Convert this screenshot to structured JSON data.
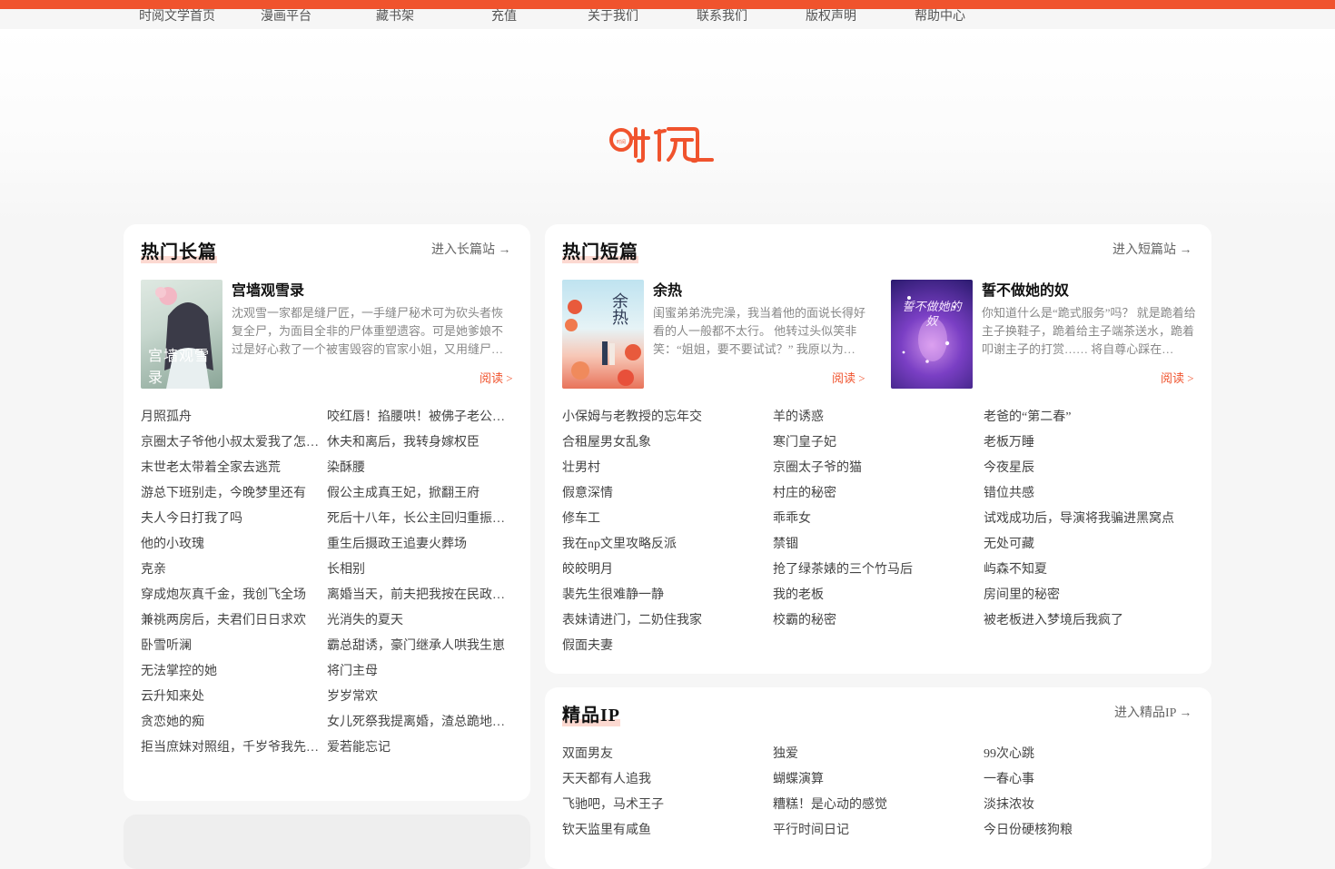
{
  "nav": [
    "时阅文学首页",
    "漫画平台",
    "藏书架",
    "充值",
    "关于我们",
    "联系我们",
    "版权声明",
    "帮助中心"
  ],
  "brand": {
    "logo_text": "时阅",
    "accent": "#f0532d"
  },
  "long_section": {
    "title": "热门长篇",
    "more": "进入长篇站 →",
    "featured": {
      "title": "宫墙观雪录",
      "cover_text": "宫墙观雪录",
      "desc": "沈观雪一家都是缝尸匠，一手缝尸秘术可为砍头者恢复全尸，为面目全非的尸体重塑遗容。可是她爹娘不过是好心救了一个被害毁容的官家小姐，又用缝尸…",
      "read": "阅读 >"
    },
    "col1": [
      "月照孤舟",
      "京圈太子爷他小叔太爱我了怎么办",
      "末世老太带着全家去逃荒",
      "游总下班别走，今晚梦里还有",
      "夫人今日打我了吗",
      "他的小玫瑰",
      "克亲",
      "穿成炮灰真千金，我创飞全场",
      "兼祧两房后，夫君们日日求欢",
      "卧雪听澜",
      "无法掌控的她",
      "云升知来处",
      "贪恋她的痴",
      "拒当庶妹对照组，千岁爷我先撩为敬"
    ],
    "col2": [
      "咬红唇！掐腰哄！被佛子老公宠上天",
      "休夫和离后，我转身嫁权臣",
      "染酥腰",
      "假公主成真王妃，掀翻王府",
      "死后十八年，长公主回归重振朝纲",
      "重生后摄政王追妻火葬场",
      "长相别",
      "离婚当天，前夫把我按在民政局门口",
      "光消失的夏天",
      "霸总甜诱，豪门继承人哄我生崽",
      "将门主母",
      "岁岁常欢",
      "女儿死祭我提离婚，渣总跪地求原谅",
      "爱若能忘记"
    ]
  },
  "short_section": {
    "title": "热门短篇",
    "more": "进入短篇站 →",
    "featured": [
      {
        "title": "余热",
        "cover_text": "余热",
        "desc": "闺蜜弟弟洗完澡，我当着他的面说长得好看的人一般都不太行。 他转过头似笑非笑：“姐姐，要不要试试？” 我原以为…",
        "read": "阅读 >"
      },
      {
        "title": "誓不做她的奴",
        "cover_text": "誓不做她的奴",
        "desc": "你知道什么是“跪式服务”吗？ 就是跪着给主子换鞋子，跪着给主子端茶送水，跪着叩谢主子的打赏…… 将自尊心踩在…",
        "read": "阅读 >"
      }
    ],
    "col1": [
      "小保姆与老教授的忘年交",
      "合租屋男女乱象",
      "壮男村",
      "假意深情",
      "修车工",
      "我在np文里攻略反派",
      "皎皎明月",
      "裴先生很难静一静",
      "表妹请进门，二奶住我家",
      "假面夫妻"
    ],
    "col2": [
      "羊的诱惑",
      "寒门皇子妃",
      "京圈太子爷的猫",
      "村庄的秘密",
      "乖乖女",
      "禁锢",
      "抢了绿茶婊的三个竹马后",
      "我的老板",
      "校霸的秘密"
    ],
    "col3": [
      "老爸的“第二春”",
      "老板万睡",
      "今夜星辰",
      "错位共感",
      "试戏成功后，导演将我骗进黑窝点",
      "无处可藏",
      "屿森不知夏",
      "房间里的秘密",
      "被老板进入梦境后我疯了"
    ]
  },
  "ip_section": {
    "title": "精品IP",
    "more": "进入精品IP →",
    "col1": [
      "双面男友",
      "天天都有人追我",
      "飞驰吧，马术王子",
      "钦天监里有咸鱼"
    ],
    "col2": [
      "独爱",
      "蝴蝶演算",
      "糟糕！是心动的感觉",
      "平行时间日记"
    ],
    "col3": [
      "99次心跳",
      "一春心事",
      "淡抹浓妆",
      "今日份硬核狗粮"
    ]
  }
}
